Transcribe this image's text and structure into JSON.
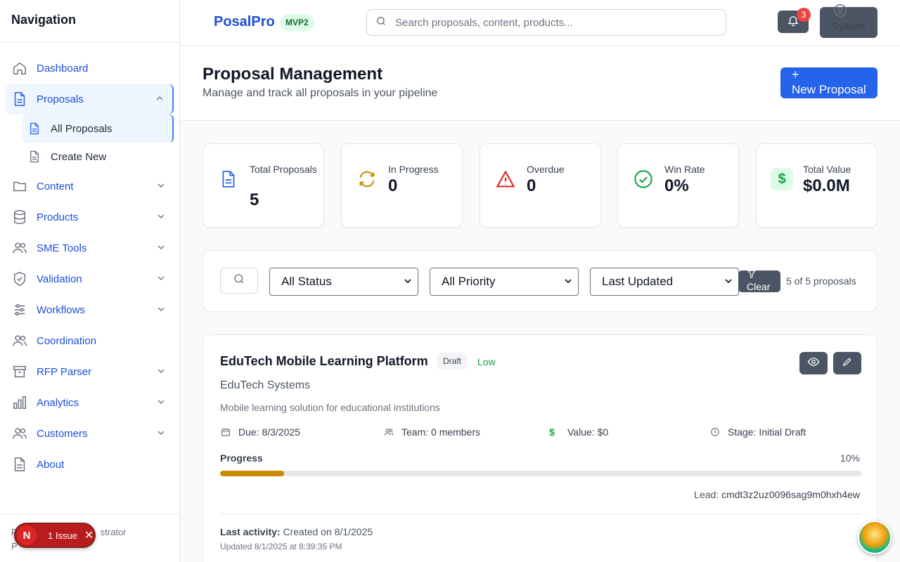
{
  "sidebar": {
    "title": "Navigation",
    "items": [
      {
        "label": "Dashboard"
      },
      {
        "label": "Proposals"
      },
      {
        "label": "Content"
      },
      {
        "label": "Products"
      },
      {
        "label": "SME Tools"
      },
      {
        "label": "Validation"
      },
      {
        "label": "Workflows"
      },
      {
        "label": "Coordination"
      },
      {
        "label": "RFP Parser"
      },
      {
        "label": "Analytics"
      },
      {
        "label": "Customers"
      },
      {
        "label": "About"
      }
    ],
    "sub_items": [
      {
        "label": "All Proposals"
      },
      {
        "label": "Create New"
      }
    ],
    "footer_line1": "P",
    "footer_role": "strator",
    "footer_line2": "P"
  },
  "issue_pill": {
    "letter": "N",
    "label": "1 Issue",
    "close": "✕"
  },
  "topbar": {
    "brand": "PosalPro",
    "badge": "MVP2",
    "search_placeholder": "Search proposals, content, products...",
    "notification_count": "3",
    "user_label": "System"
  },
  "header": {
    "title": "Proposal Management",
    "subtitle": "Manage and track all proposals in your pipeline",
    "new_button": "New Proposal"
  },
  "stats": [
    {
      "label": "Total Proposals",
      "value": "5"
    },
    {
      "label": "In Progress",
      "value": "0"
    },
    {
      "label": "Overdue",
      "value": "0"
    },
    {
      "label": "Win Rate",
      "value": "0%"
    },
    {
      "label": "Total Value",
      "value": "$0.0M"
    }
  ],
  "filters": {
    "status": "All Status",
    "priority": "All Priority",
    "sort": "Last Updated",
    "clear": "Clear",
    "count": "5 of 5 proposals"
  },
  "proposal": {
    "title": "EduTech Mobile Learning Platform",
    "status": "Draft",
    "priority": "Low",
    "client": "EduTech Systems",
    "description": "Mobile learning solution for educational institutions",
    "due": "Due: 8/3/2025",
    "team": "Team: 0 members",
    "value": "Value: $0",
    "stage": "Stage: Initial Draft",
    "progress_label": "Progress",
    "progress_text": "10%",
    "progress_fraction": 0.1,
    "lead_label": "Lead:",
    "lead_value": "cmdt3z2uz0096sag9m0hxh4ew",
    "last_activity_label": "Last activity:",
    "last_activity_value": "Created on 8/1/2025",
    "updated": "Updated 8/1/2025 at 8:39:35 PM"
  },
  "colors": {
    "accent": "#2563eb",
    "nav_text": "#1d4ed8",
    "progress": "#ca8a04",
    "low_priority": "#16a34a",
    "danger": "#dc2626"
  }
}
